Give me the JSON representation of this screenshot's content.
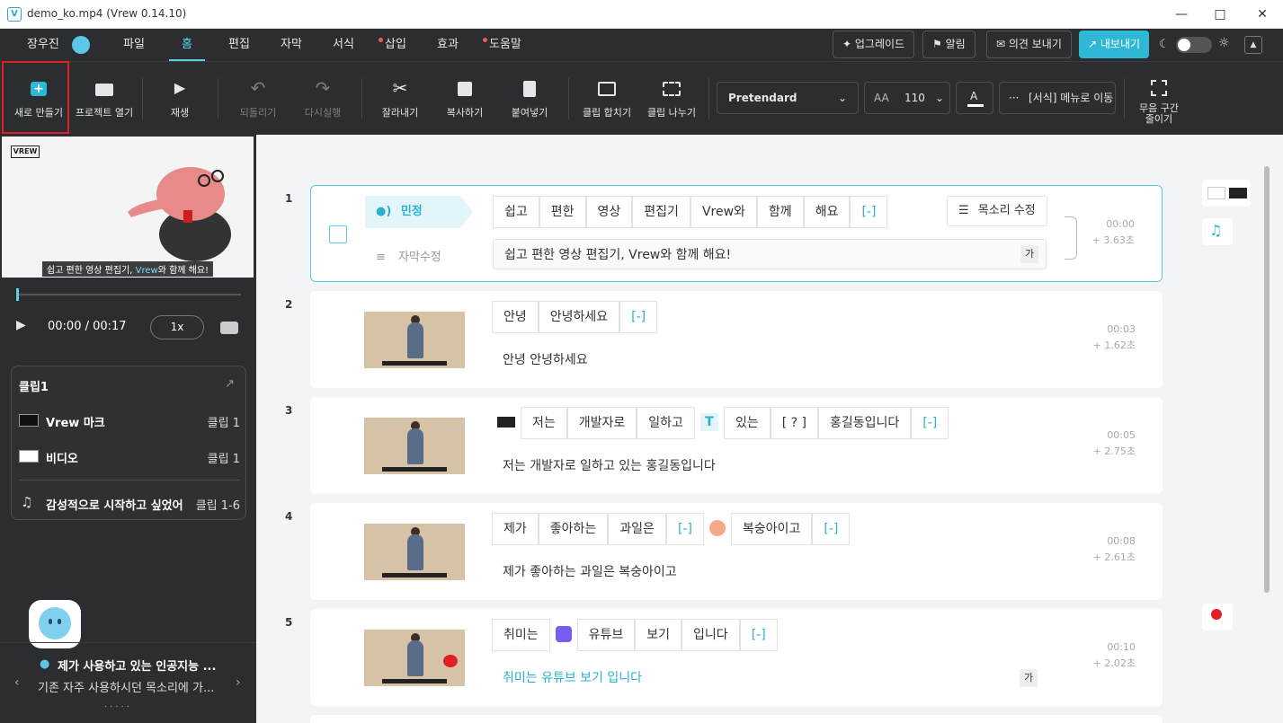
{
  "window": {
    "title": "demo_ko.mp4 (Vrew 0.14.10)"
  },
  "menubar": {
    "user": "장우진",
    "items": [
      "파일",
      "홈",
      "편집",
      "자막",
      "서식",
      "삽입",
      "효과",
      "도움말"
    ],
    "upgrade": "업그레이드",
    "alerts": "알림",
    "feedback": "의견 보내기",
    "export": "내보내기"
  },
  "toolbar": {
    "new": "새로 만들기",
    "open": "프로젝트 열기",
    "play": "재생",
    "undo": "되돌리기",
    "redo": "다시실행",
    "cut": "잘라내기",
    "copy": "복사하기",
    "paste": "붙여넣기",
    "merge": "클립 합치기",
    "split": "클립 나누기",
    "font": "Pretendard",
    "font_size": "110",
    "format_menu": "[서식] 메뉴로 이동",
    "silence_1": "무음 구간",
    "silence_2": "줄이기"
  },
  "preview": {
    "logo": "VREW",
    "subtitle_a": "쉽고 편한 영상 편집기, ",
    "subtitle_b": "Vrew",
    "subtitle_c": "와 함께 해요!",
    "time": "00:00 / 00:17",
    "speed": "1x"
  },
  "cliplist": {
    "title": "클립1",
    "rows": [
      {
        "name": "Vrew 마크",
        "value": "클립 1"
      },
      {
        "name": "비디오",
        "value": "클립 1"
      },
      {
        "name": "감성적으로 시작하고 싶었어",
        "value": "클립 1-6"
      }
    ]
  },
  "news": {
    "title": "제가 사용하고 있는 인공지능 ...",
    "body": "기존 자주 사용하시던 목소리에 가..."
  },
  "clips": [
    {
      "num": "1",
      "speaker": "민정",
      "edit": "자막수정",
      "voice": "목소리 수정",
      "words": [
        "쉽고",
        "편한",
        "영상",
        "편집기",
        "Vrew와",
        "함께",
        "해요",
        "[-]"
      ],
      "sub": "쉽고  편한  영상  편집기,  Vrew와  함께  해요!",
      "ga": "가",
      "start": "00:00",
      "dur": "+  3.63초"
    },
    {
      "num": "2",
      "words": [
        "안녕",
        "안녕하세요",
        "[-]"
      ],
      "sub": "안녕  안녕하세요",
      "start": "00:03",
      "dur": "+  1.62초"
    },
    {
      "num": "3",
      "words": [
        "저는",
        "개발자로",
        "일하고",
        "있는",
        "[ ? ]",
        "홍길동입니다",
        "[-]"
      ],
      "sub": "저는  개발자로  일하고  있는  홍길동입니다",
      "start": "00:05",
      "dur": "+  2.75초"
    },
    {
      "num": "4",
      "words": [
        "제가",
        "좋아하는",
        "과일은",
        "[-]",
        "복숭아이고",
        "[-]"
      ],
      "sub": "제가  좋아하는  과일은  복숭아이고",
      "start": "00:08",
      "dur": "+  2.61초"
    },
    {
      "num": "5",
      "words": [
        "취미는",
        "유튜브",
        "보기",
        "입니다",
        "[-]"
      ],
      "sub": "취미는  유튜브  보기  입니다",
      "ga": "가",
      "start": "00:10",
      "dur": "+  2.02초"
    }
  ],
  "colors": {
    "accent": "#2fb8d6",
    "dark": "#2b2d30",
    "highlight": "#e21f26"
  }
}
